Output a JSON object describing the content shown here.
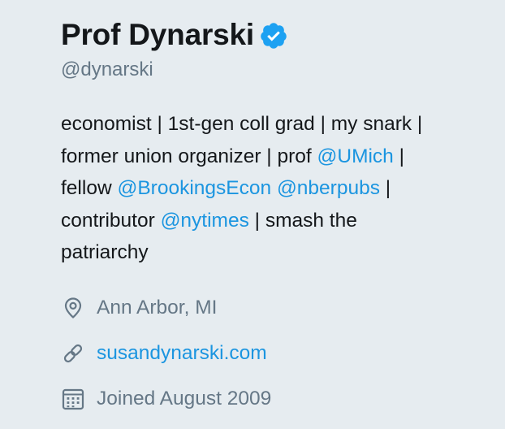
{
  "profile": {
    "name": "Prof Dynarski",
    "handle": "@dynarski",
    "verified_icon": "verified-badge-icon",
    "bio": {
      "line1": "economist | 1st-gen coll grad | my snark |",
      "line2_prefix": "former union organizer | prof ",
      "mention_umich": "@UMich",
      "line2_suffix": " |",
      "line3_prefix": "fellow ",
      "mention_brookings": "@BrookingsEcon",
      "line3_space": " ",
      "mention_nber": "@nberpubs",
      "line3_suffix": " |",
      "line4_prefix": "contributor ",
      "mention_nytimes": "@nytimes",
      "line4_suffix": " | smash the",
      "line5": "patriarchy"
    },
    "location": "Ann Arbor, MI",
    "url": "susandynarski.com",
    "joined": "Joined August 2009"
  },
  "icons": {
    "location": "location-pin-icon",
    "url": "link-icon",
    "joined": "calendar-icon"
  },
  "colors": {
    "background": "#e6ecf0",
    "text_primary": "#14171a",
    "text_secondary": "#657786",
    "link": "#1b95e0",
    "verified": "#1da1f2"
  }
}
